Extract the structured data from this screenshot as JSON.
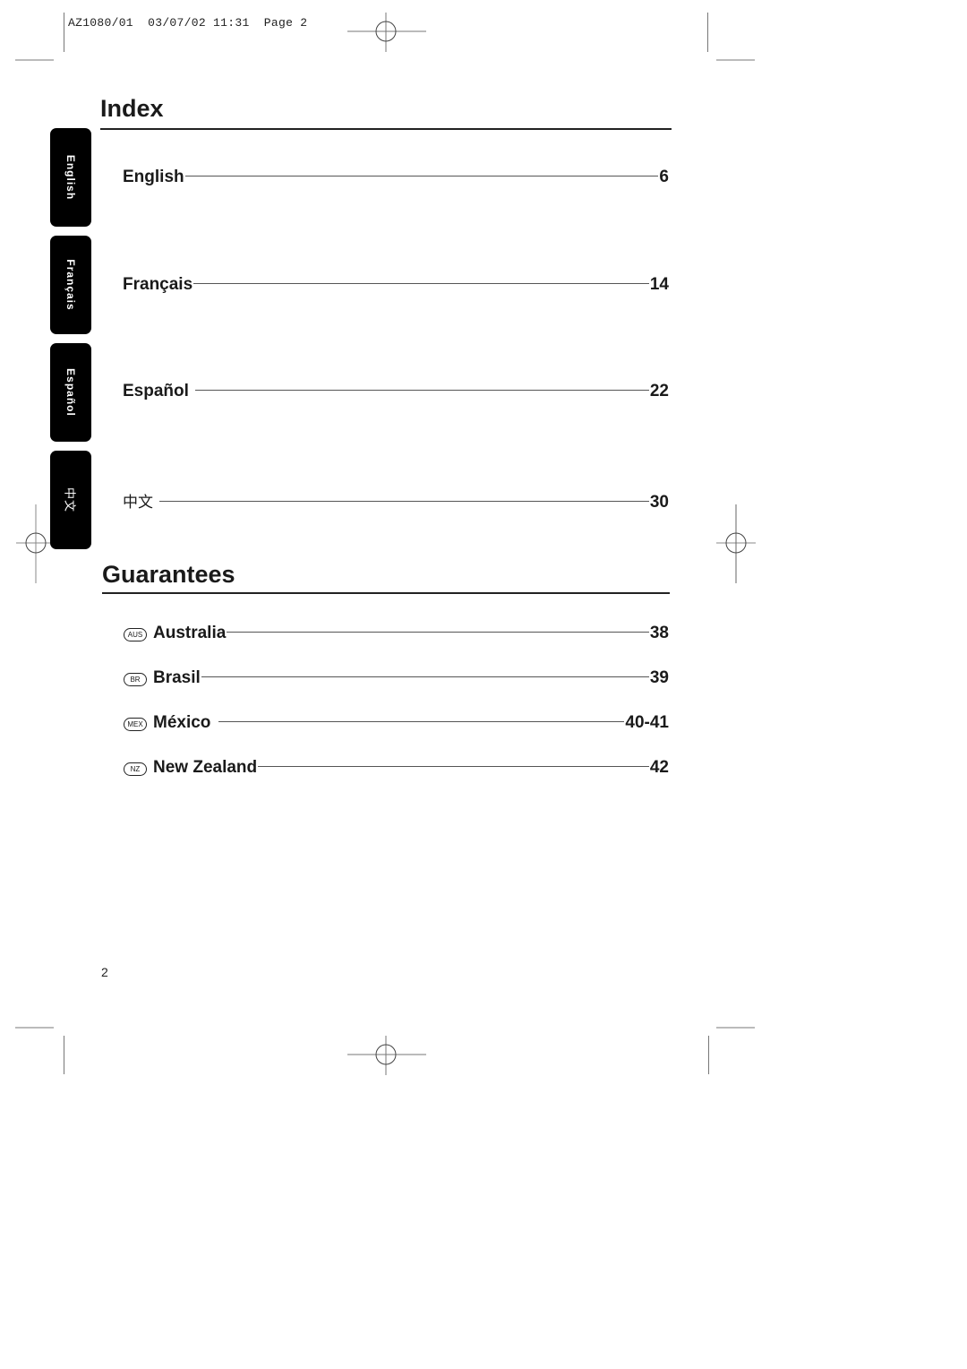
{
  "slug": {
    "code": "AZ1080/01",
    "date": "03/07/02",
    "time": "11:31",
    "page_label": "Page 2"
  },
  "index": {
    "title": "Index",
    "entries": [
      {
        "label": "English",
        "page": "6"
      },
      {
        "label": "Français",
        "page": "14"
      },
      {
        "label": "Español",
        "page": "22"
      },
      {
        "label": "中文",
        "page": "30"
      }
    ]
  },
  "language_tabs": [
    "English",
    "Français",
    "Español",
    "中文"
  ],
  "guarantees": {
    "title": "Guarantees",
    "entries": [
      {
        "badge": "AUS",
        "label": "Australia",
        "page": "38"
      },
      {
        "badge": "BR",
        "label": "Brasil",
        "page": "39"
      },
      {
        "badge": "MEX",
        "label": "México",
        "page": "40-41"
      },
      {
        "badge": "NZ",
        "label": "New Zealand",
        "page": "42"
      }
    ]
  },
  "footer": {
    "page_number": "2"
  }
}
